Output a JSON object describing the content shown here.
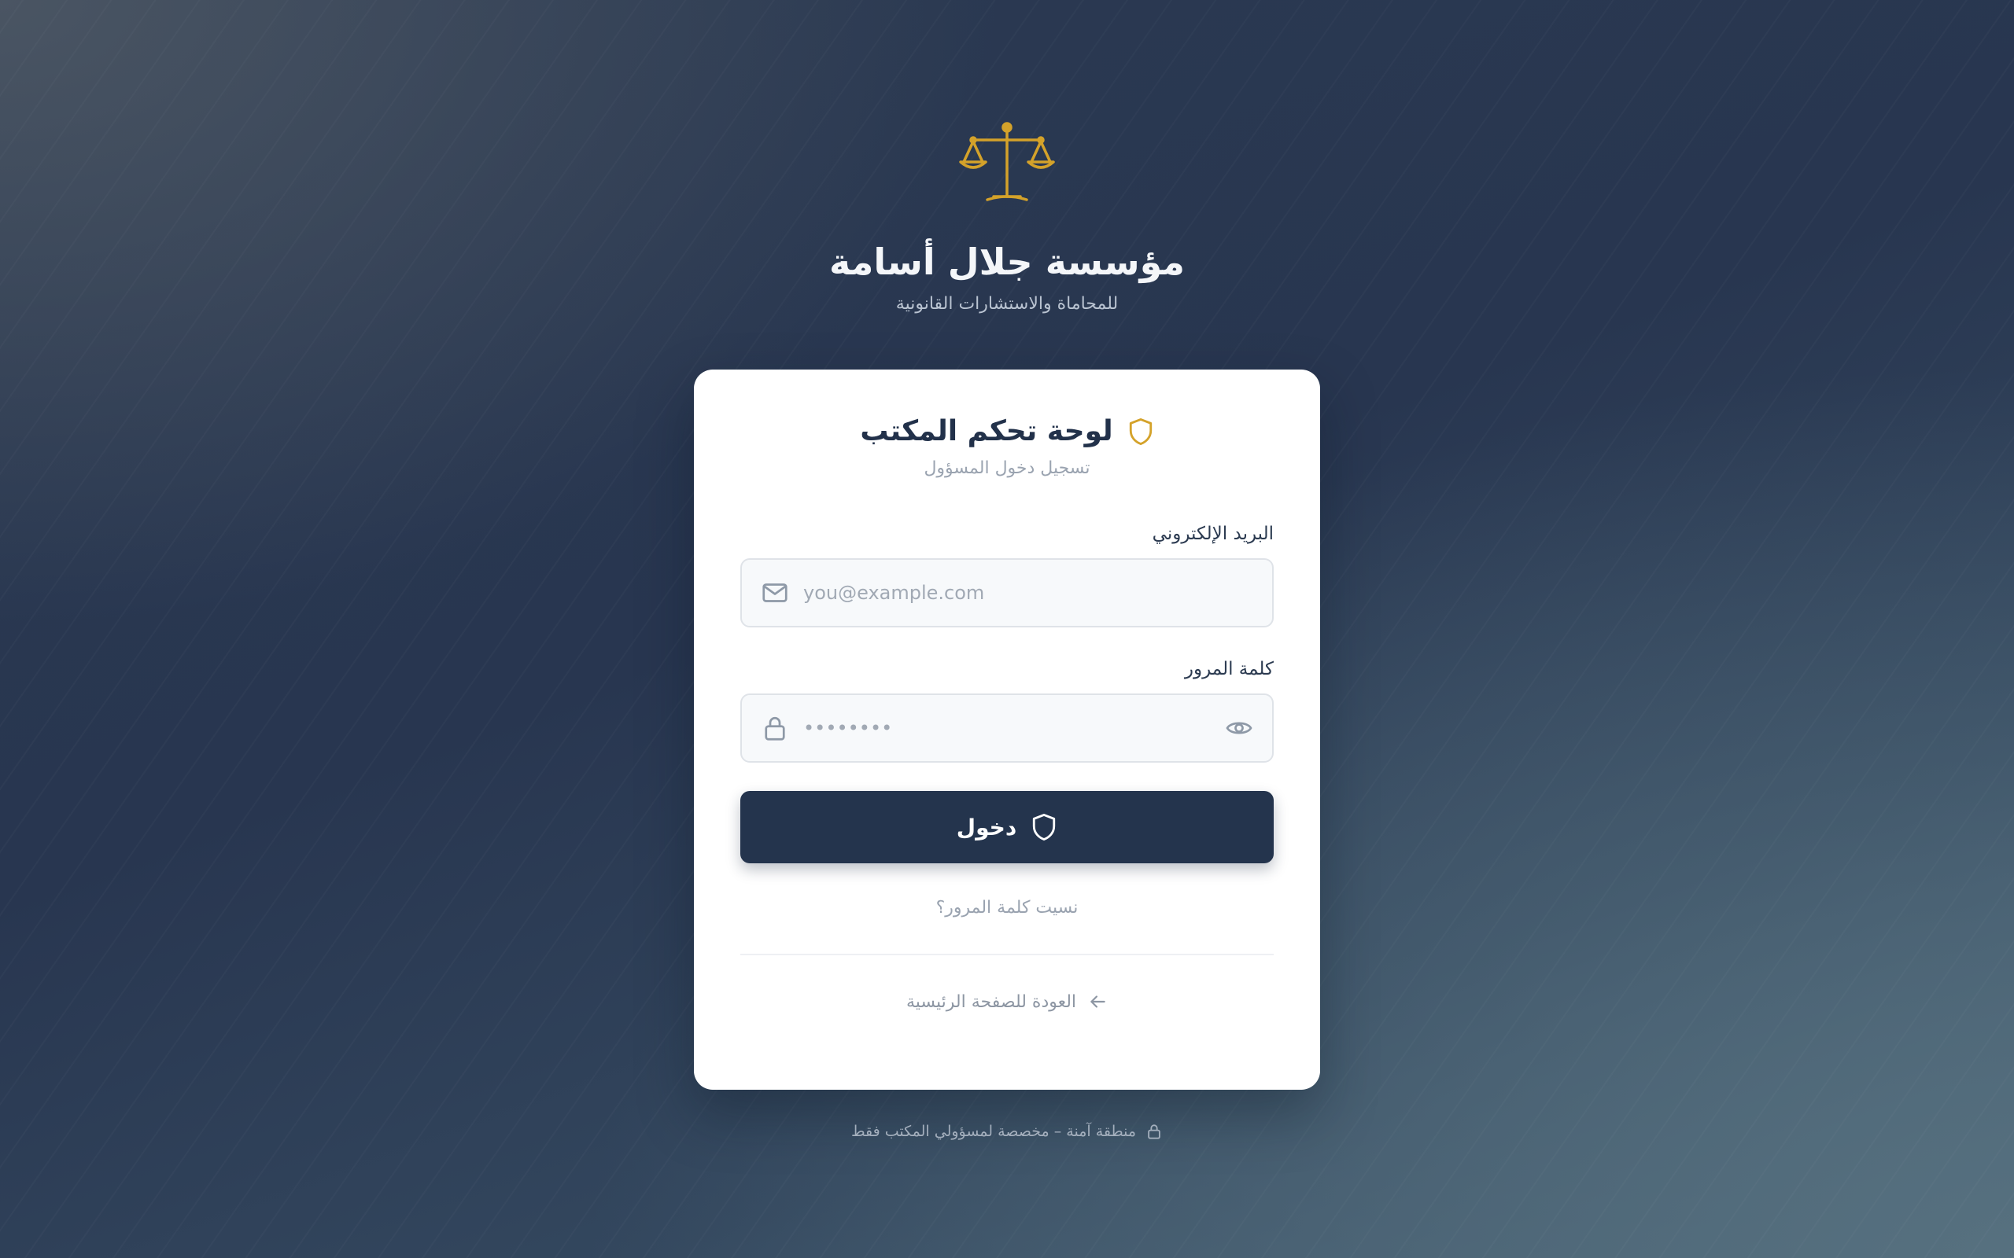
{
  "brand": {
    "logo_icon": "scales-of-justice-icon",
    "title": "مؤسسة جلال أسامة",
    "subtitle": "للمحاماة والاستشارات القانونية",
    "accent_color": "#d4a22a"
  },
  "login_card": {
    "shield_icon": "shield-icon",
    "title": "لوحة تحكم المكتب",
    "subtitle": "تسجيل دخول المسؤول",
    "email": {
      "label": "البريد الإلكتروني",
      "placeholder": "you@example.com",
      "value": "",
      "icon": "mail-icon"
    },
    "password": {
      "label": "كلمة المرور",
      "placeholder": "••••••••",
      "value": "",
      "icon": "lock-icon",
      "toggle_icon": "eye-icon"
    },
    "submit_label": "دخول",
    "submit_icon": "shield-icon",
    "forgot_password": "نسيت كلمة المرور؟",
    "back_home": "العودة للصفحة الرئيسية",
    "back_icon": "arrow-left-icon"
  },
  "footer": {
    "icon": "lock-icon",
    "text": "منطقة آمنة – مخصصة لمسؤولي المكتب فقط"
  }
}
